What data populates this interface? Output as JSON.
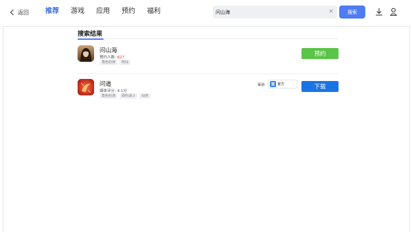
{
  "header": {
    "back_label": "返回",
    "tabs": [
      {
        "label": "推荐",
        "active": true
      },
      {
        "label": "游戏",
        "active": false
      },
      {
        "label": "应用",
        "active": false
      },
      {
        "label": "预约",
        "active": false
      },
      {
        "label": "福利",
        "active": false
      }
    ],
    "search": {
      "value": "问山海",
      "clear_icon": "×",
      "button_label": "搜索"
    },
    "icons": [
      "download-icon",
      "user-icon"
    ],
    "accent_color": "#4f7cf2"
  },
  "results": {
    "section_title": "搜索结果",
    "items": [
      {
        "name": "问山海",
        "meta_label": "预约人数:",
        "meta_value": "827",
        "tags": [
          "角色扮演",
          "修仙"
        ],
        "action_label": "预约",
        "action_color": "#5bc448",
        "icon": "game-icon-portrait"
      },
      {
        "name": "问道",
        "meta_label": "媒体评分:",
        "meta_value": "4.1分",
        "tags": [
          "角色扮演",
          "即时战斗",
          "仙侠"
        ],
        "channel_label": "渠道:",
        "channel_value": "官方",
        "channel_badge": "官",
        "action_label": "下载",
        "action_color": "#1b74e4",
        "icon": "game-icon-red"
      }
    ]
  }
}
